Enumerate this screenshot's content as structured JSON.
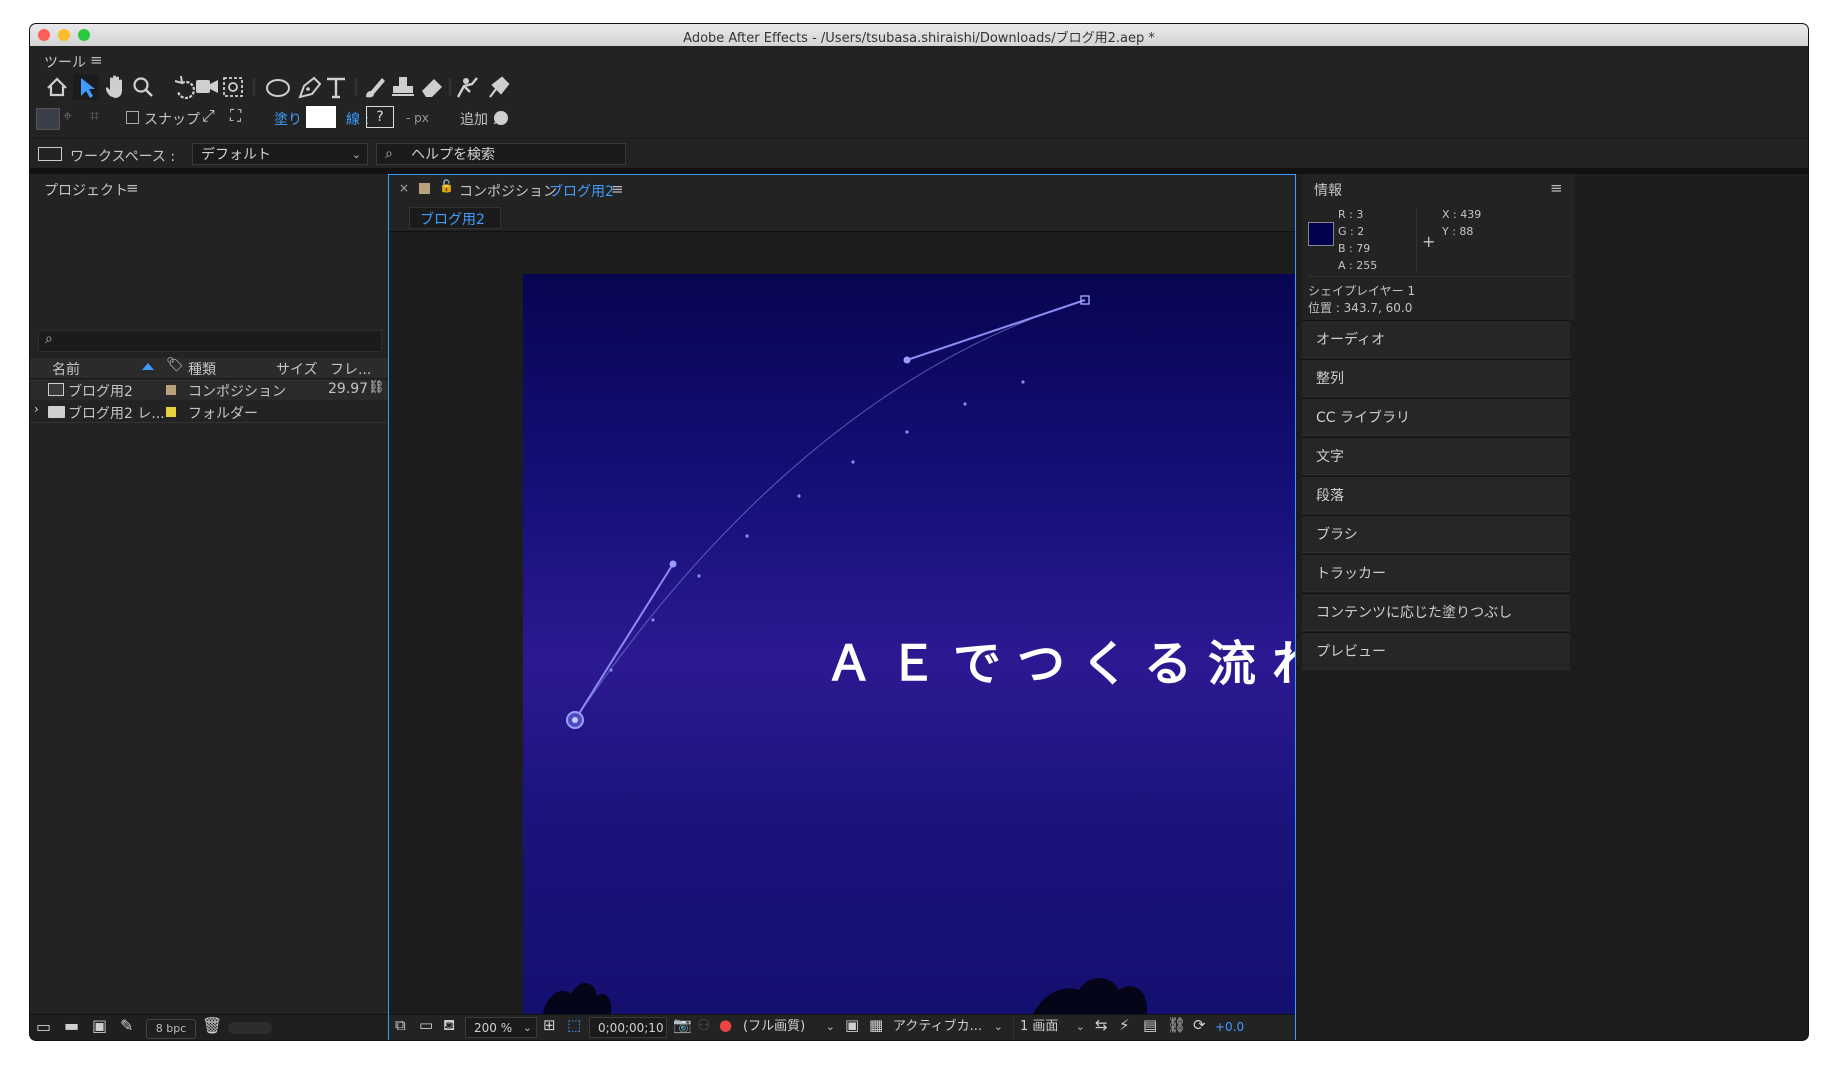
{
  "window": {
    "title": "Adobe After Effects - /Users/tsubasa.shiraishi/Downloads/ブログ用2.aep *"
  },
  "tools_panel": {
    "title": "ツール",
    "snap_label": "スナップ",
    "fill_label": "塗り :",
    "stroke_label": "線 :",
    "stroke_value": "?",
    "px_label": "- px",
    "add_label": "追加 :"
  },
  "workspace": {
    "label": "ワークスペース :",
    "value": "デフォルト",
    "search_placeholder": "ヘルプを検索"
  },
  "project": {
    "title": "プロジェクト",
    "columns": [
      "名前",
      "種類",
      "サイズ",
      "フレ..."
    ],
    "items": [
      {
        "name": "ブログ用2",
        "type": "コンポジション",
        "frame_rate": "29.97",
        "label_color": "#b8a27e"
      },
      {
        "name": "ブログ用2 レ...",
        "type": "フォルダー",
        "frame_rate": "",
        "label_color": "#e8d23c"
      }
    ],
    "bpc": "8 bpc"
  },
  "composition": {
    "tab_prefix": "コンポジション",
    "tab_name": "ブログ用2",
    "breadcrumb": "ブログ用2",
    "canvas_text": "ＡＥでつくる流れ",
    "canvas_gradient": [
      "#080552",
      "#1b1480",
      "#2c1992",
      "#141070"
    ],
    "zoom": "200 %",
    "timecode": "0;00;00;10",
    "quality": "(フル画質)",
    "camera": "アクティブカ...",
    "views": "1 画面",
    "exposure": "+0.0"
  },
  "info": {
    "title": "情報",
    "r": "R :  3",
    "g": "G :  2",
    "b": "B :  79",
    "a": "A :  255",
    "x": "X : 439",
    "y": "Y :  88",
    "swatch": "#03024f",
    "layer": "シェイプレイヤー 1",
    "position": "位置 : 343.7, 60.0"
  },
  "right_panels": [
    "オーディオ",
    "整列",
    "CC ライブラリ",
    "文字",
    "段落",
    "ブラシ",
    "トラッカー",
    "コンテンツに応じた塗りつぶし",
    "プレビュー"
  ],
  "colors": {
    "accent": "#3f9cff",
    "bg": "#232323",
    "panel": "#1d1d1d"
  }
}
